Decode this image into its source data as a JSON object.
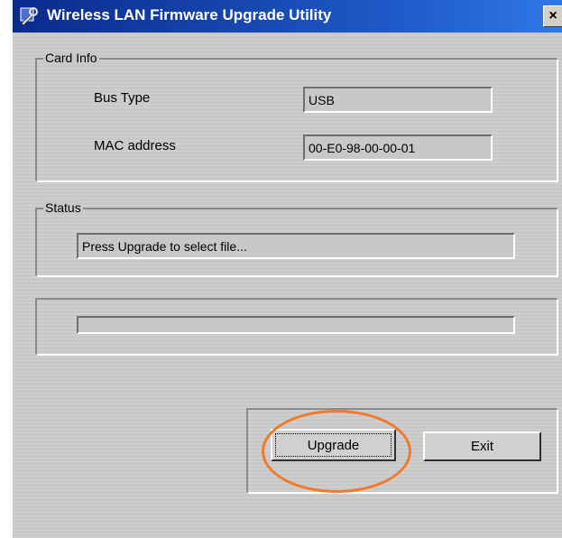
{
  "window": {
    "title": "Wireless LAN Firmware Upgrade Utility",
    "close_label": "×"
  },
  "card_info": {
    "legend": "Card Info",
    "bus_type_label": "Bus Type",
    "bus_type_value": "USB",
    "mac_label": "MAC address",
    "mac_value": "00-E0-98-00-00-01"
  },
  "status": {
    "legend": "Status",
    "message": "Press Upgrade to select file..."
  },
  "progress": {
    "value": 0
  },
  "buttons": {
    "upgrade_label": "Upgrade",
    "exit_label": "Exit"
  },
  "annotation": {
    "ring_color": "#f07a2a"
  }
}
